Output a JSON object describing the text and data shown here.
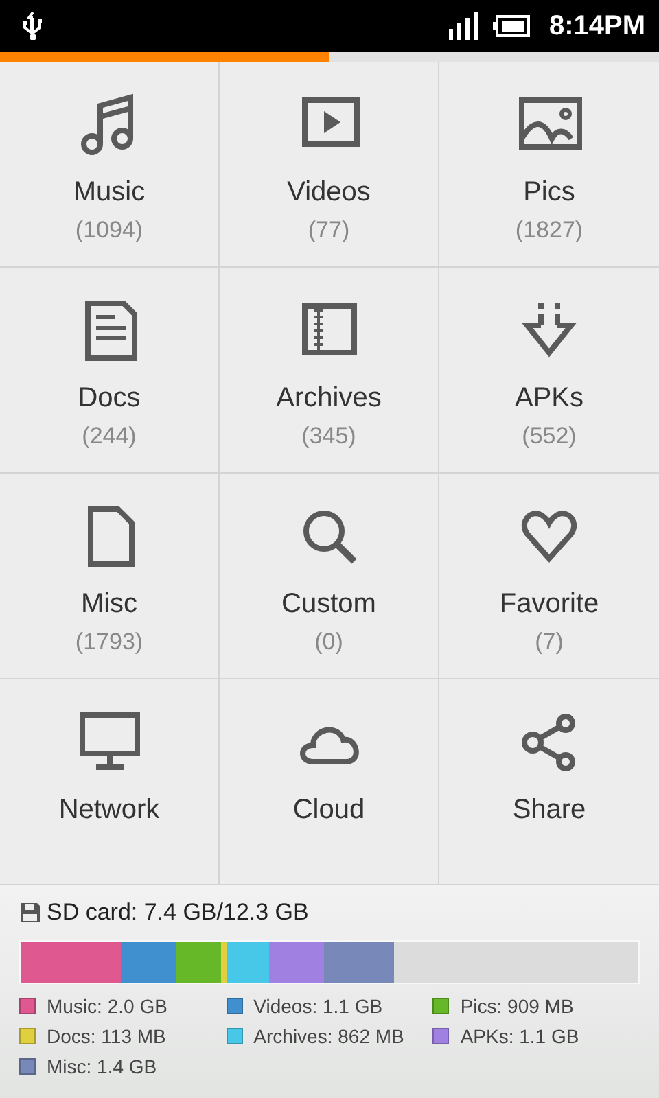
{
  "status_bar": {
    "time": "8:14PM"
  },
  "loading": {
    "level": 0.5
  },
  "tiles": [
    {
      "label": "Music",
      "count": "(1094)"
    },
    {
      "label": "Videos",
      "count": "(77)"
    },
    {
      "label": "Pics",
      "count": "(1827)"
    },
    {
      "label": "Docs",
      "count": "(244)"
    },
    {
      "label": "Archives",
      "count": "(345)"
    },
    {
      "label": "APKs",
      "count": "(552)"
    },
    {
      "label": "Misc",
      "count": "(1793)"
    },
    {
      "label": "Custom",
      "count": "(0)"
    },
    {
      "label": "Favorite",
      "count": "(7)"
    },
    {
      "label": "Network"
    },
    {
      "label": "Cloud"
    },
    {
      "label": "Share"
    }
  ],
  "storage": {
    "title": "SD card: 7.4 GB/12.3 GB",
    "segments": [
      {
        "label": "Music: 2.0 GB",
        "color": "#e05890"
      },
      {
        "label": "Videos: 1.1 GB",
        "color": "#4090d0"
      },
      {
        "label": "Pics: 909 MB",
        "color": "#66b828"
      },
      {
        "label": "Docs: 113 MB",
        "color": "#e0d040"
      },
      {
        "label": "Archives: 862 MB",
        "color": "#48c8e8"
      },
      {
        "label": "APKs: 1.1 GB",
        "color": "#a080e0"
      },
      {
        "label": "Misc: 1.4 GB",
        "color": "#7888b8"
      }
    ]
  }
}
